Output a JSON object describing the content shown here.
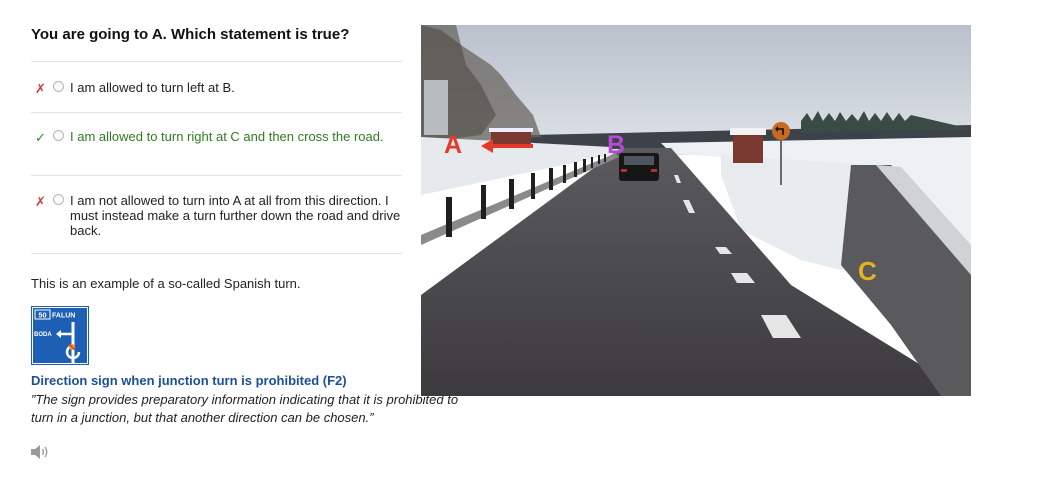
{
  "question": "You are going to A. Which statement is true?",
  "answers": [
    {
      "mark": "✗",
      "status": "wrong",
      "text": "I am allowed to turn left at B."
    },
    {
      "mark": "✓",
      "status": "correct",
      "text": "I am allowed to turn right at C and then cross the road."
    },
    {
      "mark": "✗",
      "status": "wrong",
      "text": "I am not allowed to turn into A at all from this direction. I must instead make a turn further down the road and drive back."
    }
  ],
  "explanation": "This is an example of a so-called Spanish turn.",
  "sign": {
    "road_number": "50",
    "destination_top": "FALUN",
    "destination_left": "BODA",
    "caption": "Direction sign when junction turn is prohibited (F2)",
    "quote": "”The sign provides preparatory information indicating that it is prohibited to turn in a junction, but that another direction can be chosen.”"
  },
  "photo": {
    "labels": {
      "a": "A",
      "b": "B",
      "c": "C"
    }
  },
  "icons": {
    "speaker": "speaker-icon"
  },
  "colors": {
    "wrong": "#d83a3a",
    "correct": "#2f7d1f",
    "caption": "#1f4e99",
    "sign_blue": "#1d5fb4",
    "label_a": "#e53a2a",
    "label_b": "#b84ad8",
    "label_c": "#e8b21a"
  }
}
